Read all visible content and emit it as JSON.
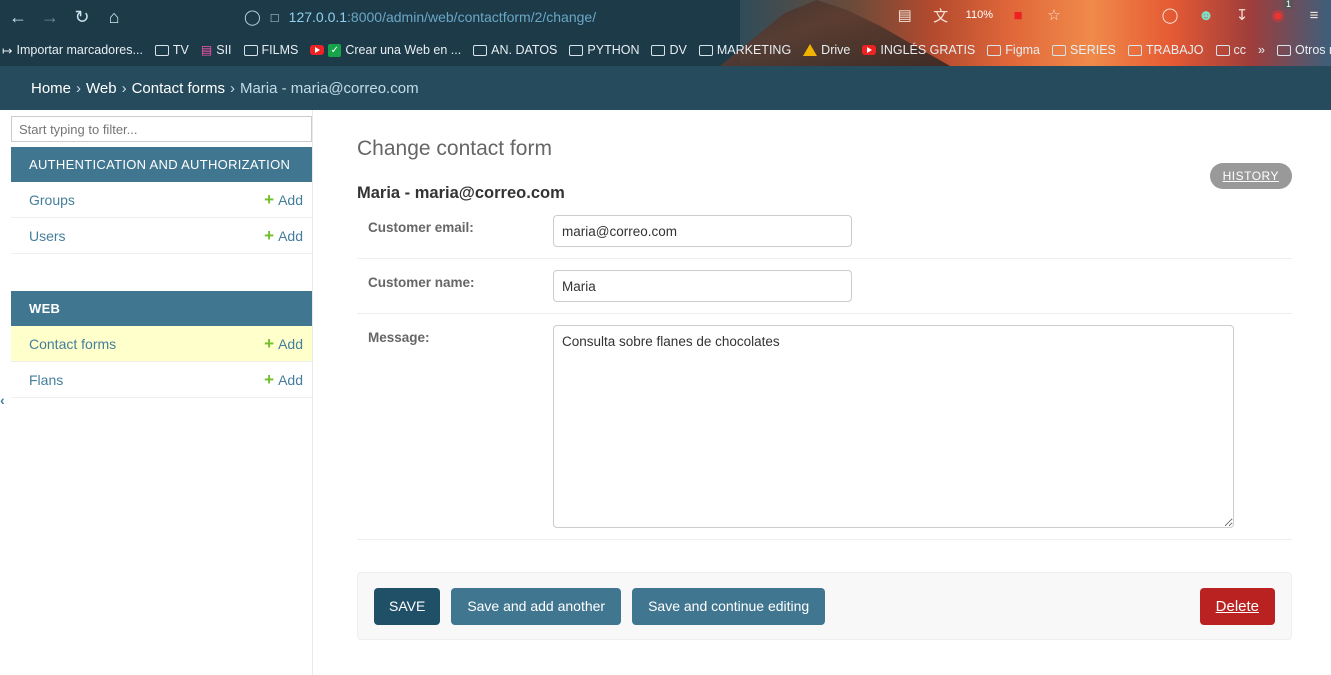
{
  "browser": {
    "url_host": "127.0.0.1",
    "url_path": ":8000/admin/web/contactform/2/change/",
    "zoom": "110%",
    "notification_count": "1",
    "bookmarks": [
      {
        "label": "Importar marcadores...",
        "icon": "import-icon"
      },
      {
        "label": "TV",
        "icon": "folder-icon"
      },
      {
        "label": "SII",
        "icon": "sii-icon"
      },
      {
        "label": "FILMS",
        "icon": "folder-icon"
      },
      {
        "label": "Crear una Web en ...",
        "icon": "youtube-check-icon"
      },
      {
        "label": "AN. DATOS",
        "icon": "folder-icon"
      },
      {
        "label": "PYTHON",
        "icon": "folder-icon"
      },
      {
        "label": "DV",
        "icon": "folder-icon"
      },
      {
        "label": "MARKETING",
        "icon": "folder-icon"
      },
      {
        "label": "Drive",
        "icon": "drive-icon"
      },
      {
        "label": "INGLÉS GRATIS",
        "icon": "youtube-icon"
      },
      {
        "label": "Figma",
        "icon": "folder-icon"
      },
      {
        "label": "SERIES",
        "icon": "folder-icon"
      },
      {
        "label": "TRABAJO",
        "icon": "folder-icon"
      },
      {
        "label": "cc",
        "icon": "folder-icon"
      },
      {
        "label": "Otros marcadores",
        "icon": "folder-icon"
      }
    ]
  },
  "breadcrumbs": {
    "home": "Home",
    "app": "Web",
    "model": "Contact forms",
    "current": "Maria - maria@correo.com",
    "separator": "›"
  },
  "sidebar": {
    "filter_placeholder": "Start typing to filter...",
    "add_label": "Add",
    "modules": [
      {
        "caption": "AUTHENTICATION AND AUTHORIZATION",
        "items": [
          {
            "label": "Groups"
          },
          {
            "label": "Users"
          }
        ]
      },
      {
        "caption": "WEB",
        "items": [
          {
            "label": "Contact forms"
          },
          {
            "label": "Flans"
          }
        ]
      }
    ]
  },
  "content": {
    "page_title": "Change contact form",
    "history_label": "HISTORY",
    "object_title": "Maria - maria@correo.com",
    "fields": {
      "email_label": "Customer email:",
      "email_value": "maria@correo.com",
      "name_label": "Customer name:",
      "name_value": "Maria",
      "message_label": "Message:",
      "message_value": "Consulta sobre flanes de chocolates"
    },
    "buttons": {
      "save": "SAVE",
      "save_add_another": "Save and add another",
      "save_continue": "Save and continue editing",
      "delete": "Delete"
    }
  },
  "colors": {
    "header": "#264b5d",
    "module_caption": "#417690",
    "link": "#447e9b",
    "active_row": "#ffffcc",
    "add_plus": "#70bf2b",
    "save_button": "#205067",
    "delete_button": "#ba2121"
  }
}
